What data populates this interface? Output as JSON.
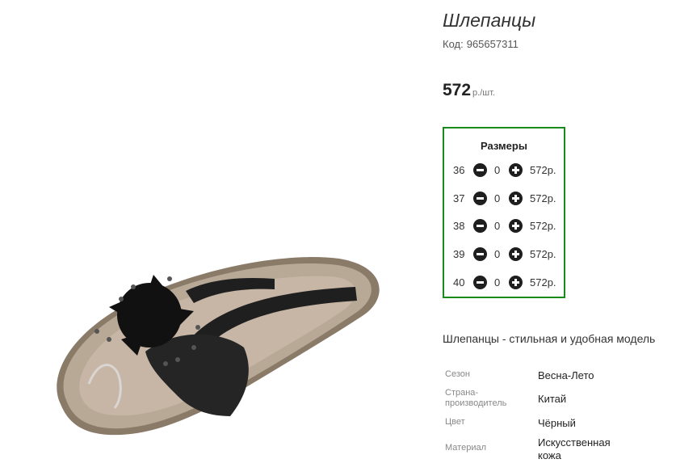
{
  "product": {
    "title": "Шлепанцы",
    "code_label": "Код:",
    "code_value": "965657311",
    "price_amount": "572",
    "price_unit": "р./шт."
  },
  "sizes": {
    "title": "Размеры",
    "rows": [
      {
        "size": "36",
        "qty": "0",
        "price": "572р."
      },
      {
        "size": "37",
        "qty": "0",
        "price": "572р."
      },
      {
        "size": "38",
        "qty": "0",
        "price": "572р."
      },
      {
        "size": "39",
        "qty": "0",
        "price": "572р."
      },
      {
        "size": "40",
        "qty": "0",
        "price": "572р."
      }
    ]
  },
  "description": "Шлепанцы - стильная и удобная модель",
  "attributes": [
    {
      "key": "Сезон",
      "value": "Весна-Лето"
    },
    {
      "key": "Страна-производитель",
      "value": "Китай"
    },
    {
      "key": "Цвет",
      "value": "Чёрный"
    },
    {
      "key": "Материал",
      "value": "Искусственная кожа"
    }
  ],
  "icons": {
    "decrement": "minus-circle-icon",
    "increment": "plus-circle-icon"
  },
  "colors": {
    "sizes_border": "#1a8a1a",
    "icon_fill": "#1e1e1e"
  }
}
